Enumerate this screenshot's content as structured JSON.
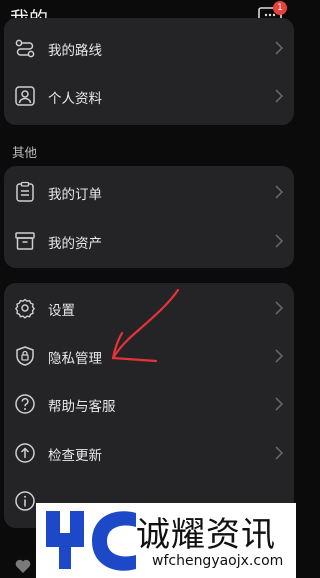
{
  "header": {
    "title": "我的",
    "message_badge": "1"
  },
  "card_top": {
    "items": [
      {
        "label": "我的路线",
        "icon": "route-icon"
      },
      {
        "label": "个人资料",
        "icon": "profile-icon"
      }
    ]
  },
  "section_other": {
    "title": "其他"
  },
  "card_middle": {
    "items": [
      {
        "label": "我的订单",
        "icon": "order-clipboard-icon"
      },
      {
        "label": "我的资产",
        "icon": "assets-box-icon"
      }
    ]
  },
  "card_bottom": {
    "items": [
      {
        "label": "设置",
        "icon": "gear-icon"
      },
      {
        "label": "隐私管理",
        "icon": "privacy-shield-icon"
      },
      {
        "label": "帮助与客服",
        "icon": "help-icon"
      },
      {
        "label": "检查更新",
        "icon": "update-arrow-icon"
      },
      {
        "label": "",
        "icon": "info-icon"
      }
    ]
  },
  "annotation": {
    "color": "#e8323b",
    "icon": "hand-drawn-arrow"
  },
  "watermark": {
    "name": "诚耀资讯",
    "url": "wfchengyaojx.com",
    "logo_color": "#1d49c9"
  },
  "colors": {
    "background": "#0b0b0c",
    "card": "#242426",
    "badge": "#e8403a"
  }
}
